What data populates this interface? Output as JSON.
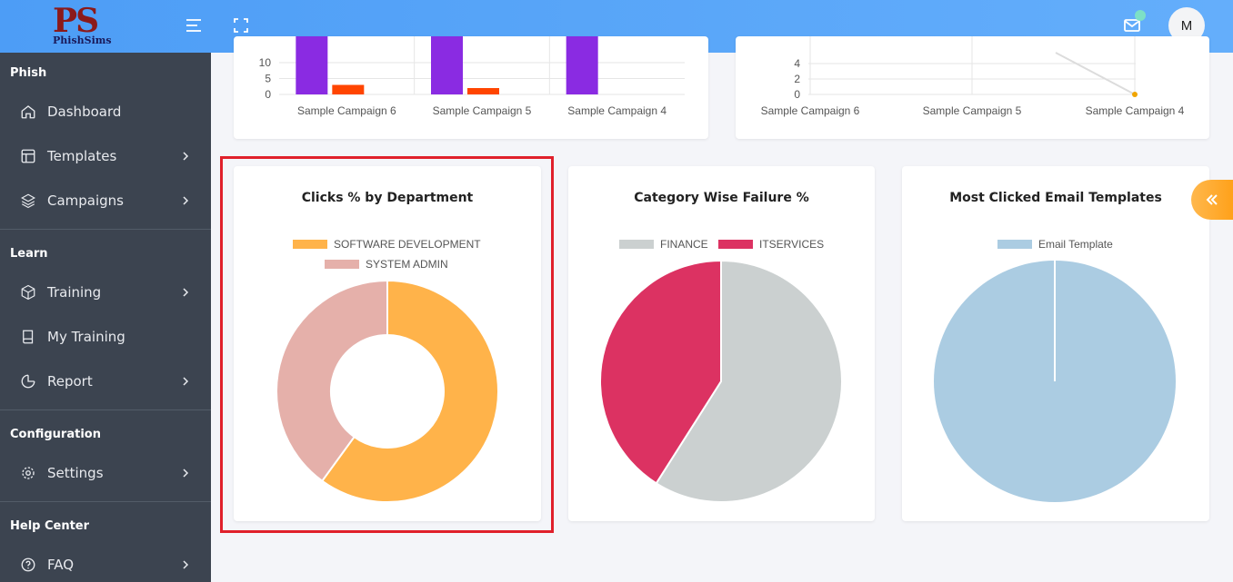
{
  "brand": {
    "logo_letters": "PS",
    "logo_name": "PhishSims"
  },
  "header": {
    "avatar_initial": "M"
  },
  "sidebar": {
    "sections": [
      {
        "title": "Phish"
      },
      {
        "title": "Learn"
      },
      {
        "title": "Configuration"
      },
      {
        "title": "Help Center"
      }
    ],
    "items": [
      {
        "label": "Dashboard"
      },
      {
        "label": "Templates"
      },
      {
        "label": "Campaigns"
      },
      {
        "label": "Training"
      },
      {
        "label": "My Training"
      },
      {
        "label": "Report"
      },
      {
        "label": "Settings"
      },
      {
        "label": "FAQ"
      }
    ]
  },
  "top_bar_chart": {
    "type": "bar",
    "categories": [
      "Sample Campaign 6",
      "Sample Campaign 5",
      "Sample Campaign 4"
    ],
    "y_ticks": [
      "0",
      "5",
      "10"
    ],
    "series": [
      {
        "color": "#8a2be2",
        "values": [
          null,
          null,
          null
        ]
      },
      {
        "color": "#ff4500",
        "values": [
          3,
          2,
          0
        ]
      }
    ]
  },
  "top_line_chart": {
    "type": "line",
    "categories": [
      "Sample Campaign 6",
      "Sample Campaign 5",
      "Sample Campaign 4"
    ],
    "y_ticks": [
      "0",
      "2",
      "4"
    ],
    "last_point_value": 0
  },
  "chart_data": [
    {
      "type": "pie",
      "title": "Clicks % by Department",
      "style": "doughnut",
      "labels": [
        "SOFTWARE DEVELOPMENT",
        "SYSTEM ADMIN"
      ],
      "values": [
        60,
        40
      ],
      "colors": [
        "#ffb34a",
        "#e5b0aa"
      ]
    },
    {
      "type": "pie",
      "title": "Category Wise Failure %",
      "labels": [
        "FINANCE",
        "ITSERVICES"
      ],
      "values": [
        59,
        41
      ],
      "colors": [
        "#cbd0d0",
        "#dc3262"
      ]
    },
    {
      "type": "pie",
      "title": "Most Clicked Email Templates",
      "labels": [
        "Email Template"
      ],
      "values": [
        100
      ],
      "colors": [
        "#abcce2"
      ]
    }
  ]
}
